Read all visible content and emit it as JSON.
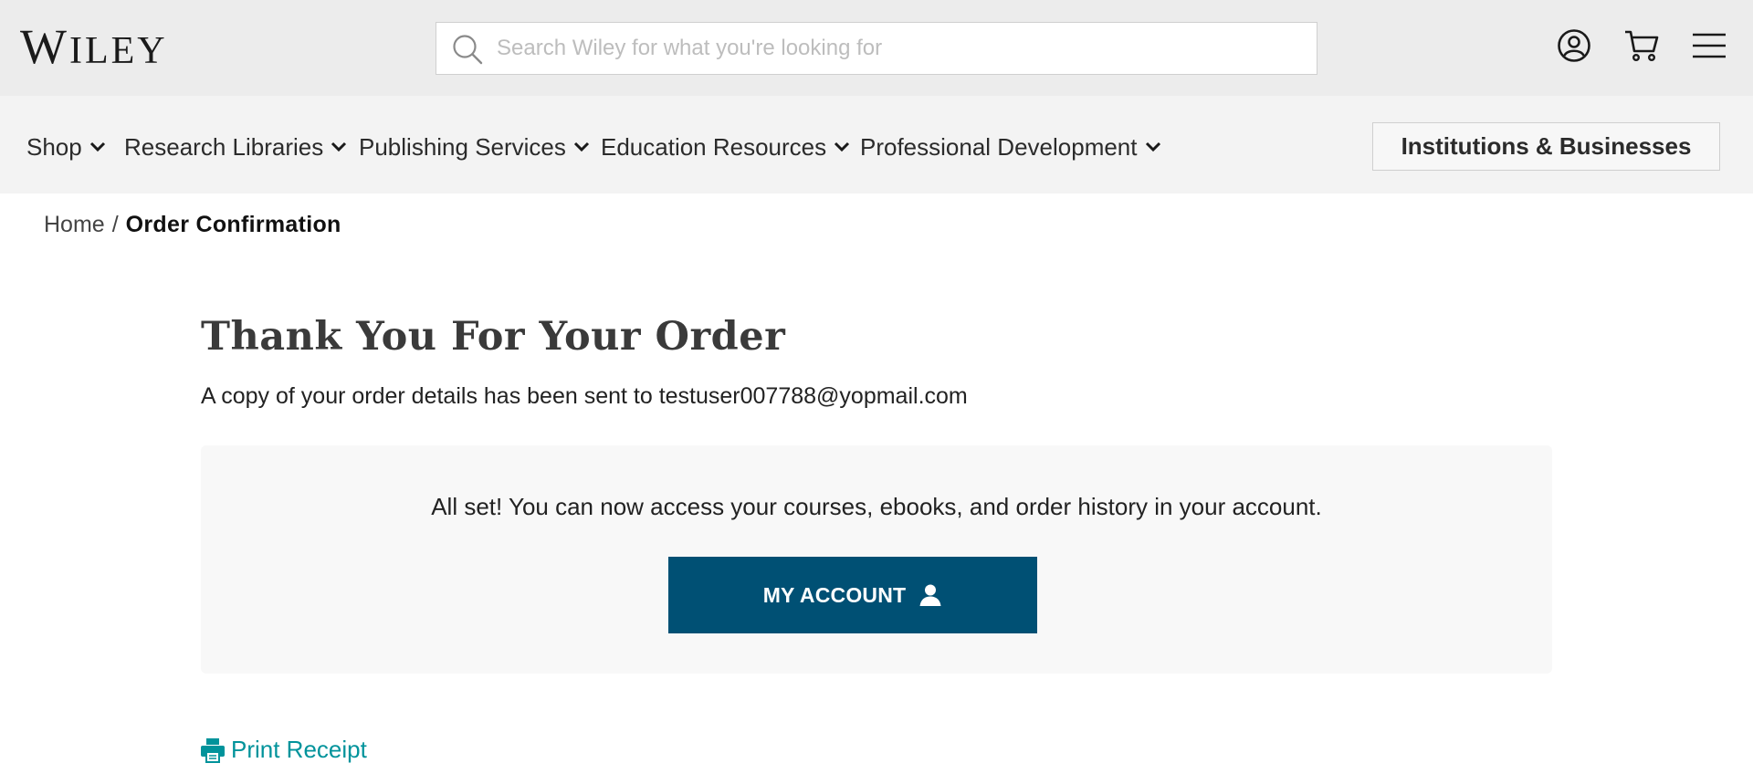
{
  "header": {
    "logo_first": "W",
    "logo_rest": "ILEY",
    "search": {
      "placeholder": "Search Wiley for what you're looking for",
      "value": ""
    },
    "icons": [
      "account-icon",
      "cart-icon",
      "menu-icon"
    ]
  },
  "nav": {
    "items": [
      {
        "label": "Shop"
      },
      {
        "label": "Research Libraries"
      },
      {
        "label": "Publishing Services"
      },
      {
        "label": "Education Resources"
      },
      {
        "label": "Professional Development"
      }
    ],
    "institutions_label": "Institutions & Businesses"
  },
  "breadcrumb": {
    "home": "Home",
    "separator": "/",
    "current": "Order Confirmation"
  },
  "main": {
    "title": "Thank You For Your Order",
    "subtitle": "A copy of your order details has been sent to testuser007788@yopmail.com",
    "panel_message": "All set! You can now access your courses, ebooks, and order history in your account.",
    "account_button": "MY ACCOUNT",
    "print_label": "Print Receipt"
  },
  "colors": {
    "header_bg": "#ececec",
    "nav_bg": "#f3f3f3",
    "primary_button": "#005074",
    "link": "#00939b",
    "panel_bg": "#f8f8f8"
  }
}
